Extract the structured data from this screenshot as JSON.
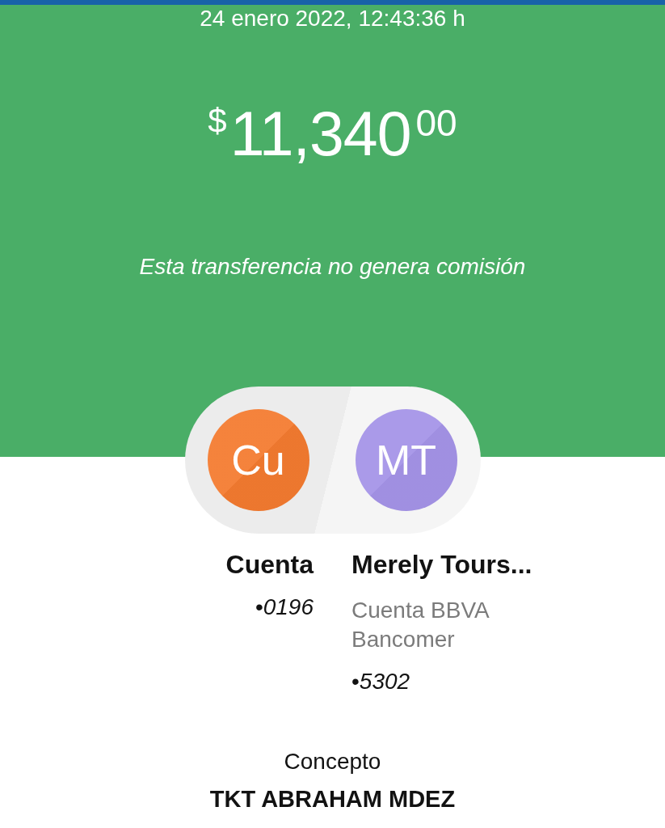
{
  "header": {
    "datetime": "24 enero 2022, 12:43:36 h",
    "amount": {
      "currency": "$",
      "integer": "11,340",
      "cents": "00"
    },
    "note": "Esta transferencia no genera comisión"
  },
  "parties": [
    {
      "initials": "Cu",
      "color": "#f47b30",
      "name": "Cuenta",
      "account": "•*0196*"
    },
    {
      "initials": "MT",
      "color": "#a594e8",
      "name": "Merely Tours...",
      "bank": "Cuenta BBVA Bancomer",
      "account": "•*5302*"
    }
  ],
  "concept": {
    "label": "Concepto",
    "value": "TKT ABRAHAM MDEZ"
  }
}
